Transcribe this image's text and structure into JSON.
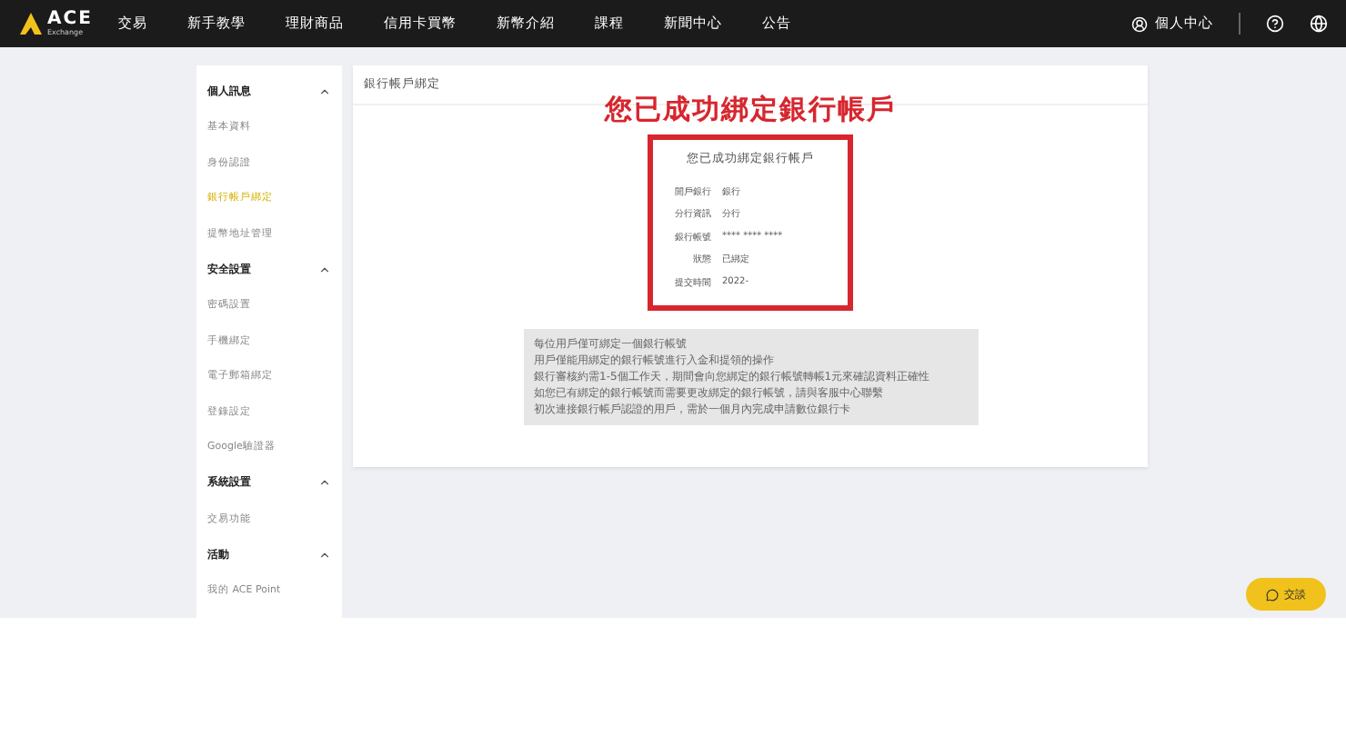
{
  "nav": {
    "logo": "ACE",
    "logo_sub": "Exchange",
    "items": [
      "交易",
      "新手教學",
      "理財商品",
      "信用卡買幣",
      "新幣介紹",
      "課程",
      "新聞中心",
      "公告"
    ],
    "account": "個人中心"
  },
  "sidebar": [
    {
      "title": "個人訊息",
      "expanded": true,
      "items": [
        {
          "label": "基本資料",
          "selected": false
        },
        {
          "label": "身份認證",
          "selected": false
        },
        {
          "label": "銀行帳戶綁定",
          "selected": true
        },
        {
          "label": "提幣地址管理",
          "selected": false
        }
      ]
    },
    {
      "title": "安全設置",
      "expanded": true,
      "items": [
        {
          "label": "密碼設置",
          "selected": false
        },
        {
          "label": "手機綁定",
          "selected": false
        },
        {
          "label": "電子郵箱綁定",
          "selected": false
        },
        {
          "label": "登錄設定",
          "selected": false
        },
        {
          "label": "Google驗證器",
          "selected": false
        }
      ]
    },
    {
      "title": "系統設置",
      "expanded": true,
      "items": [
        {
          "label": "交易功能",
          "selected": false
        }
      ]
    },
    {
      "title": "活動",
      "expanded": true,
      "items": [
        {
          "label": "我的 ACE Point",
          "selected": false
        }
      ]
    }
  ],
  "card": {
    "title": "銀行帳戶綁定",
    "banner": "您已成功綁定銀行帳戶",
    "result": {
      "title": "您已成功綁定銀行帳戶",
      "rows": [
        {
          "label": "開戶銀行",
          "value": "銀行"
        },
        {
          "label": "分行資訊",
          "value": "分行"
        },
        {
          "label": "銀行帳號",
          "value": "**** **** ****"
        },
        {
          "label": "狀態",
          "value": "已綁定"
        },
        {
          "label": "提交時間",
          "value": "2022-"
        }
      ]
    },
    "notes": [
      "每位用戶僅可綁定一個銀行帳號",
      "用戶僅能用綁定的銀行帳號進行入金和提領的操作",
      "銀行審核約需1-5個工作天，期間會向您綁定的銀行帳號轉帳1元來確認資料正確性",
      "如您已有綁定的銀行帳號而需要更改綁定的銀行帳號，請與客服中心聯繫",
      "初次連接銀行帳戶認證的用戶，需於一個月內完成申請數位銀行卡"
    ]
  },
  "chat": {
    "label": "交談"
  }
}
